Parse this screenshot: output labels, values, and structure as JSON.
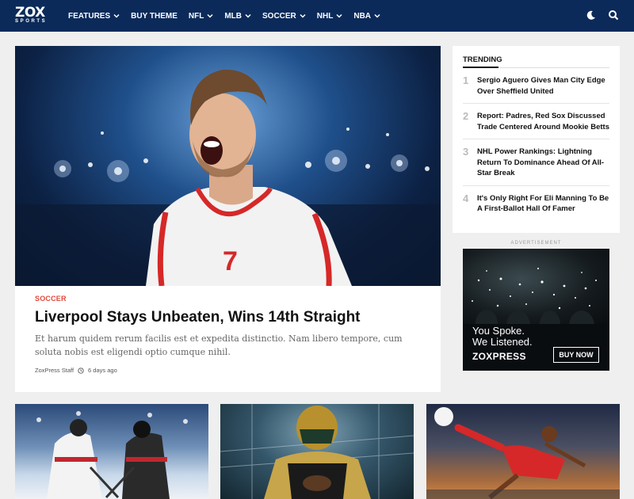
{
  "brand": {
    "logo": "ZOX",
    "logo_sub": "SPORTS"
  },
  "nav": {
    "items": [
      {
        "label": "FEATURES",
        "dropdown": true
      },
      {
        "label": "BUY THEME",
        "dropdown": false
      },
      {
        "label": "NFL",
        "dropdown": true
      },
      {
        "label": "MLB",
        "dropdown": true
      },
      {
        "label": "SOCCER",
        "dropdown": true
      },
      {
        "label": "NHL",
        "dropdown": true
      },
      {
        "label": "NBA",
        "dropdown": true
      }
    ],
    "icons": [
      "moon-icon",
      "search-icon"
    ]
  },
  "hero": {
    "category": "SOCCER",
    "title": "Liverpool Stays Unbeaten, Wins 14th Straight",
    "excerpt": "Et harum quidem rerum facilis est et expedita distinctio. Nam libero tempore, cum soluta nobis est eligendi optio cumque nihil.",
    "author": "ZoxPress Staff",
    "time": "6 days ago",
    "jersey_number": "7"
  },
  "trending": {
    "heading": "TRENDING",
    "items": [
      {
        "num": "1",
        "title": "Sergio Aguero Gives Man City Edge Over Sheffield United"
      },
      {
        "num": "2",
        "title": "Report: Padres, Red Sox Discussed Trade Centered Around Mookie Betts"
      },
      {
        "num": "3",
        "title": "NHL Power Rankings: Lightning Return To Dominance Ahead Of All-Star Break"
      },
      {
        "num": "4",
        "title": "It's Only Right For Eli Manning To Be A First-Ballot Hall Of Famer"
      }
    ]
  },
  "ad": {
    "label": "ADVERTISEMENT",
    "line1": "You Spoke.",
    "line2": "We Listened.",
    "brand": "ZOXPRESS",
    "button": "BUY NOW"
  },
  "colors": {
    "nav_bg": "#0b2a5a",
    "accent": "#e4473b",
    "page_bg": "#efefef"
  }
}
